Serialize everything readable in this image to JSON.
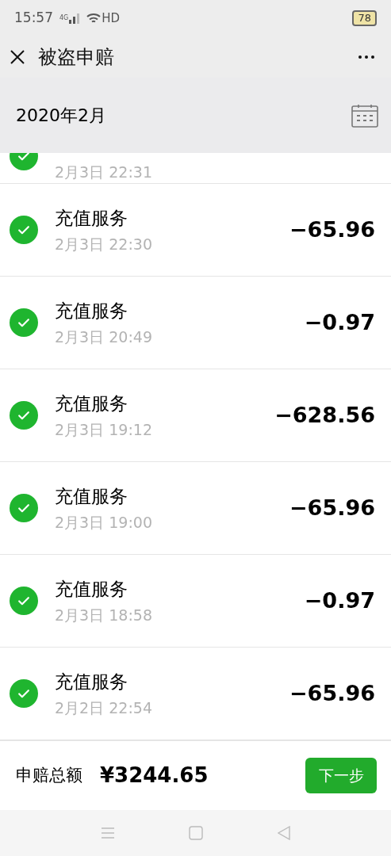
{
  "status_bar": {
    "time": "15:57",
    "network": "4G",
    "hd": "HD",
    "battery": "78"
  },
  "title_bar": {
    "title": "被盗申赔"
  },
  "month_header": {
    "month": "2020年2月"
  },
  "transactions": [
    {
      "kind": "partial",
      "date": "2月3日 22:31",
      "checked": true
    },
    {
      "kind": "full",
      "title": "充值服务",
      "date": "2月3日 22:30",
      "amount": "−65.96",
      "checked": true
    },
    {
      "kind": "full",
      "title": "充值服务",
      "date": "2月3日 20:49",
      "amount": "−0.97",
      "checked": true
    },
    {
      "kind": "full",
      "title": "充值服务",
      "date": "2月3日 19:12",
      "amount": "−628.56",
      "checked": true
    },
    {
      "kind": "full",
      "title": "充值服务",
      "date": "2月3日 19:00",
      "amount": "−65.96",
      "checked": true
    },
    {
      "kind": "full",
      "title": "充值服务",
      "date": "2月3日 18:58",
      "amount": "−0.97",
      "checked": true
    },
    {
      "kind": "full",
      "title": "充值服务",
      "date": "2月2日 22:54",
      "amount": "−65.96",
      "checked": true
    }
  ],
  "footer": {
    "label": "申赔总额",
    "total": "¥3244.65",
    "button": "下一步"
  }
}
